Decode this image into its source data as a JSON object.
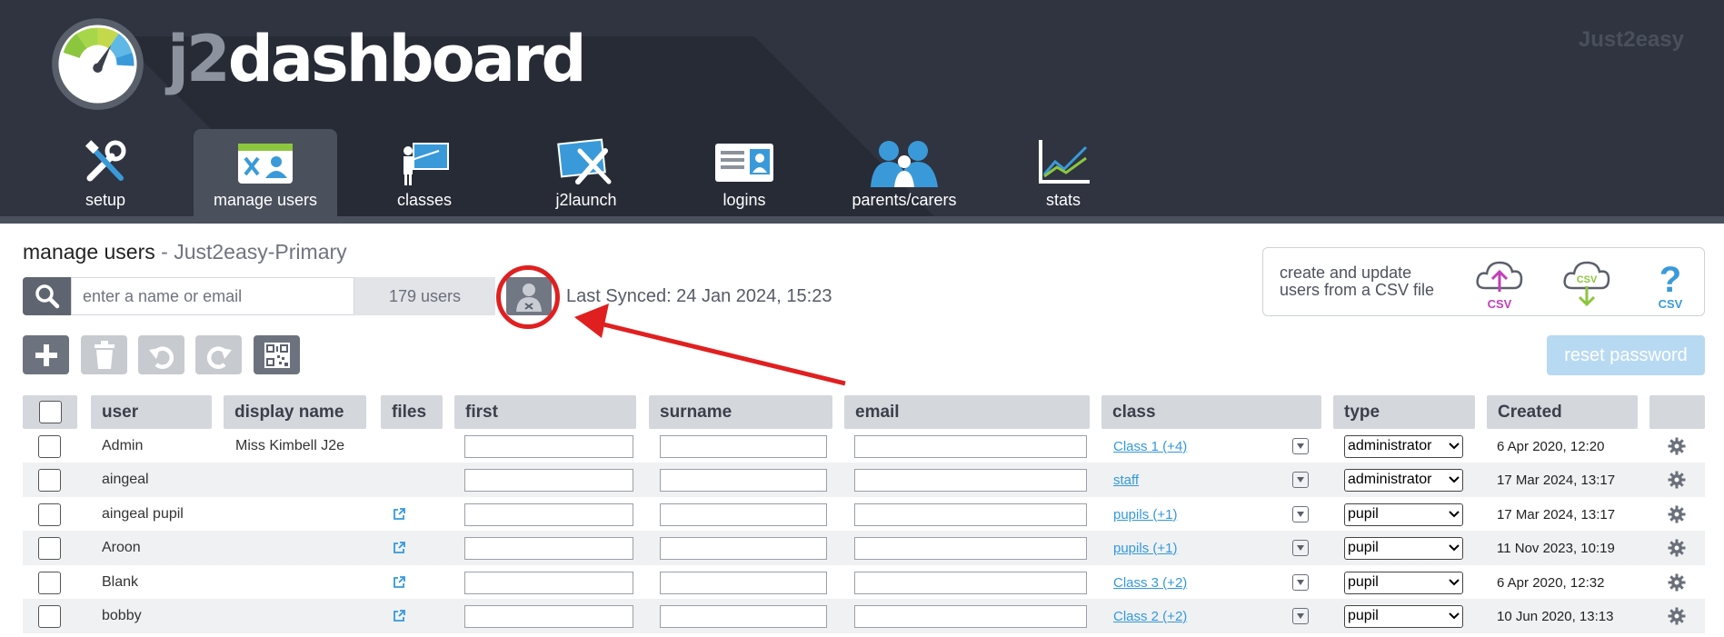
{
  "header": {
    "brand_prefix": "j2",
    "brand_suffix": "dashboard",
    "org": "Just2easy"
  },
  "nav": [
    {
      "label": "setup",
      "icon": "tools-icon"
    },
    {
      "label": "manage users",
      "icon": "manage-users-icon",
      "active": true
    },
    {
      "label": "classes",
      "icon": "classes-icon"
    },
    {
      "label": "j2launch",
      "icon": "j2launch-icon"
    },
    {
      "label": "logins",
      "icon": "logins-icon"
    },
    {
      "label": "parents/carers",
      "icon": "parents-icon"
    },
    {
      "label": "stats",
      "icon": "stats-icon"
    }
  ],
  "page": {
    "title": "manage users",
    "separator": " - ",
    "subtitle": "Just2easy-Primary"
  },
  "search": {
    "placeholder": "enter a name or email",
    "count": "179 users"
  },
  "sync": {
    "text": "Last Synced: 24 Jan 2024, 15:23"
  },
  "csv": {
    "line1": "create and update",
    "line2": "users from a CSV file",
    "icon_label": "CSV"
  },
  "toolbar": {
    "reset_label": "reset password"
  },
  "table": {
    "headers": {
      "user": "user",
      "display_name": "display name",
      "files": "files",
      "first": "first",
      "surname": "surname",
      "email": "email",
      "class": "class",
      "type": "type",
      "created": "Created"
    },
    "rows": [
      {
        "user": "Admin",
        "display_name": "Miss Kimbell J2e",
        "files": false,
        "class": "Class 1 (+4)",
        "type": "administrator",
        "created": "6 Apr 2020, 12:20"
      },
      {
        "user": "aingeal",
        "display_name": "",
        "files": false,
        "class": "staff",
        "type": "administrator",
        "created": "17 Mar 2024, 13:17"
      },
      {
        "user": "aingeal pupil",
        "display_name": "",
        "files": true,
        "class": "pupils (+1)",
        "type": "pupil",
        "created": "17 Mar 2024, 13:17"
      },
      {
        "user": "Aroon",
        "display_name": "",
        "files": true,
        "class": "pupils (+1)",
        "type": "pupil",
        "created": "11 Nov 2023, 10:19"
      },
      {
        "user": "Blank",
        "display_name": "",
        "files": true,
        "class": "Class 3 (+2)",
        "type": "pupil",
        "created": "6 Apr 2020, 12:32"
      },
      {
        "user": "bobby",
        "display_name": "",
        "files": true,
        "class": "Class 2 (+2)",
        "type": "pupil",
        "created": "10 Jun 2020, 13:13"
      }
    ]
  },
  "colors": {
    "header_bg": "#2f3440",
    "accent_red": "#e02020",
    "link": "#3399dd"
  }
}
